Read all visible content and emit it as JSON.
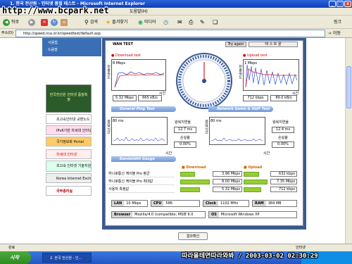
{
  "window": {
    "title": "1. 한국 전산원 - 인터넷 품질 테스트 - Microsoft Internet Explorer",
    "min": "_",
    "max": "□",
    "close": "x"
  },
  "watermark": "http://www.bcpark.net",
  "menu": {
    "help": "도움말(H)"
  },
  "toolbar": {
    "back": "뒤로",
    "search": "검색",
    "favorites": "즐겨찾기",
    "media": "미디어",
    "links": "링크"
  },
  "address": {
    "label": "주소(D)",
    "url": "http://speed.nca.or.kr/speedtest/default.asp",
    "go": "이동"
  },
  "sidebar": {
    "items": [
      "사용법",
      "도움말"
    ]
  },
  "banners": [
    "한국전산원 인터넷 품질측정",
    "초고속인터넷 교환노드",
    "IPv6기반 차세대 인터넷망",
    "국가정보화 Portal",
    "차세대 인터넷",
    "초고속 인터넷 기술지원 시스템",
    "Korea Internet Exchange",
    "국무총리실"
  ],
  "test": {
    "wan_label": "WAN TEST",
    "try_again": "Try again",
    "test_done": "테 스 트 끝",
    "download": {
      "title": "Download test",
      "max": "8 Mbps",
      "ylabel": "전송속도",
      "xlabel": "시간",
      "mbps": "5.32 Mbps",
      "kbs": "665 kB/s"
    },
    "upload": {
      "title": "Upload test",
      "max": "1 Mbps",
      "ylabel": "전송속도",
      "xlabel": "시간",
      "kbps": "712 kbps",
      "kbs": "89.0 kB/s"
    },
    "ping": {
      "title": "General Ping Test",
      "max": "80 ms",
      "ylabel": "응답시간",
      "xlabel": "시간",
      "avg_label": "왕복지연율",
      "avg": "12.7 ms",
      "loss_label": "손실율",
      "loss": "0.00%"
    },
    "game": {
      "title": "Network Game & VoIP Test",
      "max": "80 ms",
      "ylabel": "응답시간",
      "xlabel": "시간",
      "avg_label": "왕복지연율",
      "avg": "12.4 ms",
      "loss_label": "손실율",
      "loss": "0.00%"
    },
    "bandwidth": {
      "title": "Bandwidth Gauge",
      "dl_head": "Download",
      "ul_head": "Upload",
      "rows": [
        {
          "label": "하나로통신 케이블 Pro 평균",
          "dl": "3.96 Mbps",
          "dl_frac": 0.48,
          "ul": "632 kbps",
          "ul_frac": 0.62
        },
        {
          "label": "하나로통신 케이블 Pro 최대값",
          "dl": "8.00 Mbps",
          "dl_frac": 0.96,
          "ul": "7.35 Mbps",
          "ul_frac": 0.95
        },
        {
          "label": "사용자 측정값",
          "dl": "5.32 Mbps",
          "dl_frac": 0.64,
          "ul": "712 kbps",
          "ul_frac": 0.7
        }
      ]
    },
    "system": {
      "lan_k": "LAN",
      "lan": "10 Mbps",
      "cpu_k": "CPU",
      "cpu": "586",
      "clock_k": "Clock",
      "clock": "1102 MHz",
      "ram_k": "RAM",
      "ram": "384 MB",
      "browser_k": "Browser",
      "browser": "Mozilla/4.0 (compatible; MSIE 6.0",
      "os_k": "OS",
      "os": "Microsoft Windows XP"
    },
    "confirm": "결과확인"
  },
  "statusbar": {
    "text": "완료",
    "zone": "인터넷"
  },
  "taskbar": {
    "start": "시작",
    "item": "2. 한국 전산원 - 인..."
  },
  "timestamp": "따라올테면따라와봐 / 2003-03-02 02:30:29"
}
